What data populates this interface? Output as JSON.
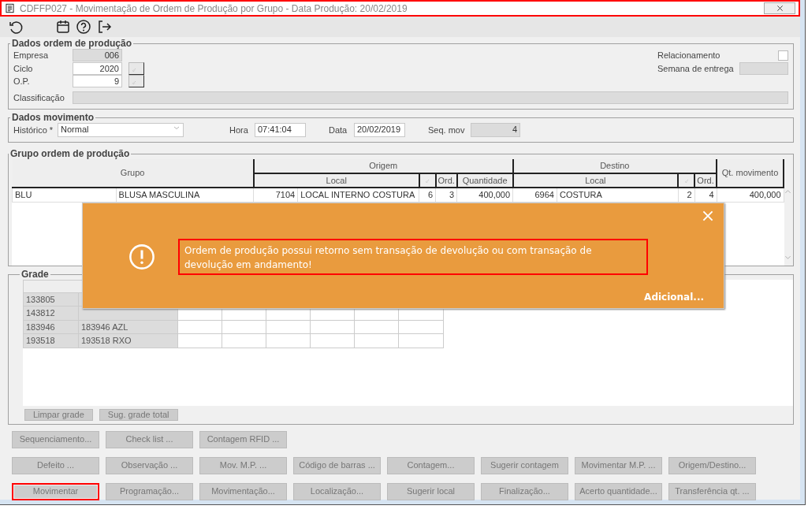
{
  "window": {
    "title": "CDFFP027 - Movimentação de Ordem de Produção por Grupo - Data Produção: 20/02/2019",
    "highlighted": true
  },
  "dados_ordem": {
    "legend": "Dados ordem de produção",
    "empresa": {
      "label": "Empresa",
      "value": "006",
      "readonly": true
    },
    "ciclo": {
      "label": "Ciclo",
      "value": "2020",
      "readonly": false
    },
    "op": {
      "label": "O.P.",
      "value": "9",
      "readonly": false
    },
    "classificacao": {
      "label": "Classificação",
      "readonly": true
    },
    "relacionamento": {
      "label": "Relacionamento",
      "checked": false
    },
    "semana_entrega": {
      "label": "Semana de entrega",
      "readonly": true
    }
  },
  "dados_movimento": {
    "legend": "Dados movimento",
    "historico": {
      "label": "Histórico *",
      "value": "Normal"
    },
    "hora": {
      "label": "Hora",
      "value": "07:41:04",
      "readonly": false
    },
    "data": {
      "label": "Data",
      "value": "20/02/2019",
      "readonly": false
    },
    "seq_mov": {
      "label": "Seq. mov",
      "value": "4",
      "readonly": true
    }
  },
  "grupo": {
    "legend": "Grupo ordem de produção",
    "headers": {
      "grupo": "Grupo",
      "origem": "Origem",
      "origem_local": "Local",
      "origem_ord": "Ord.",
      "quantidade": "Quantidade",
      "destino": "Destino",
      "destino_local": "Local",
      "destino_ord": "Ord.",
      "qt_movimento": "Qt. movimento"
    },
    "rows": [
      {
        "grupo": "BLU",
        "descricao": "BLUSA MASCULINA",
        "origem_codigo": "7104",
        "origem_local": "LOCAL INTERNO COSTURA",
        "origem_col_3": "6",
        "origem_ord": "3",
        "quantidade": "400,000",
        "destino_codigo": "6964",
        "destino_local": "COSTURA",
        "destino_col_3": "2",
        "destino_ord": "4",
        "qt_movimento": "400,000"
      }
    ]
  },
  "grade": {
    "legend": "Grade",
    "rows": [
      {
        "codigo": "133805"
      },
      {
        "codigo": "143812"
      },
      {
        "codigo": "183946",
        "nome": "183946 AZL"
      },
      {
        "codigo": "193518",
        "nome": "193518 RXO"
      }
    ],
    "buttons": [
      "Limpar grade",
      "Sug. grade total"
    ]
  },
  "button_rows": [
    [
      {
        "label": "Sequenciamento...",
        "highlighted": false
      },
      {
        "label": "Check list ...",
        "highlighted": false
      },
      {
        "label": "Contagem RFID ...",
        "highlighted": false
      }
    ],
    [
      {
        "label": "Defeito ...",
        "highlighted": false
      },
      {
        "label": "Observação ...",
        "highlighted": false
      },
      {
        "label": "Mov. M.P. ...",
        "highlighted": false
      },
      {
        "label": "Código de barras ...",
        "highlighted": false
      },
      {
        "label": "Contagem...",
        "highlighted": false
      },
      {
        "label": "Sugerir contagem",
        "highlighted": false
      },
      {
        "label": "Movimentar M.P. ...",
        "highlighted": false
      },
      {
        "label": "Origem/Destino...",
        "highlighted": false
      }
    ],
    [
      {
        "label": "Movimentar",
        "highlighted": true
      },
      {
        "label": "Programação...",
        "highlighted": false
      },
      {
        "label": "Movimentação...",
        "highlighted": false
      },
      {
        "label": "Localização...",
        "highlighted": false
      },
      {
        "label": "Sugerir local",
        "highlighted": false
      },
      {
        "label": "Finalização...",
        "highlighted": false
      },
      {
        "label": "Acerto quantidade...",
        "highlighted": false
      },
      {
        "label": "Transferência qt. ...",
        "highlighted": false
      }
    ]
  ],
  "alert": {
    "message": "Ordem de produção possui retorno sem transação de devolução ou com transação de devolução em andamento!",
    "message_highlighted": true,
    "link": "Adicional..."
  }
}
